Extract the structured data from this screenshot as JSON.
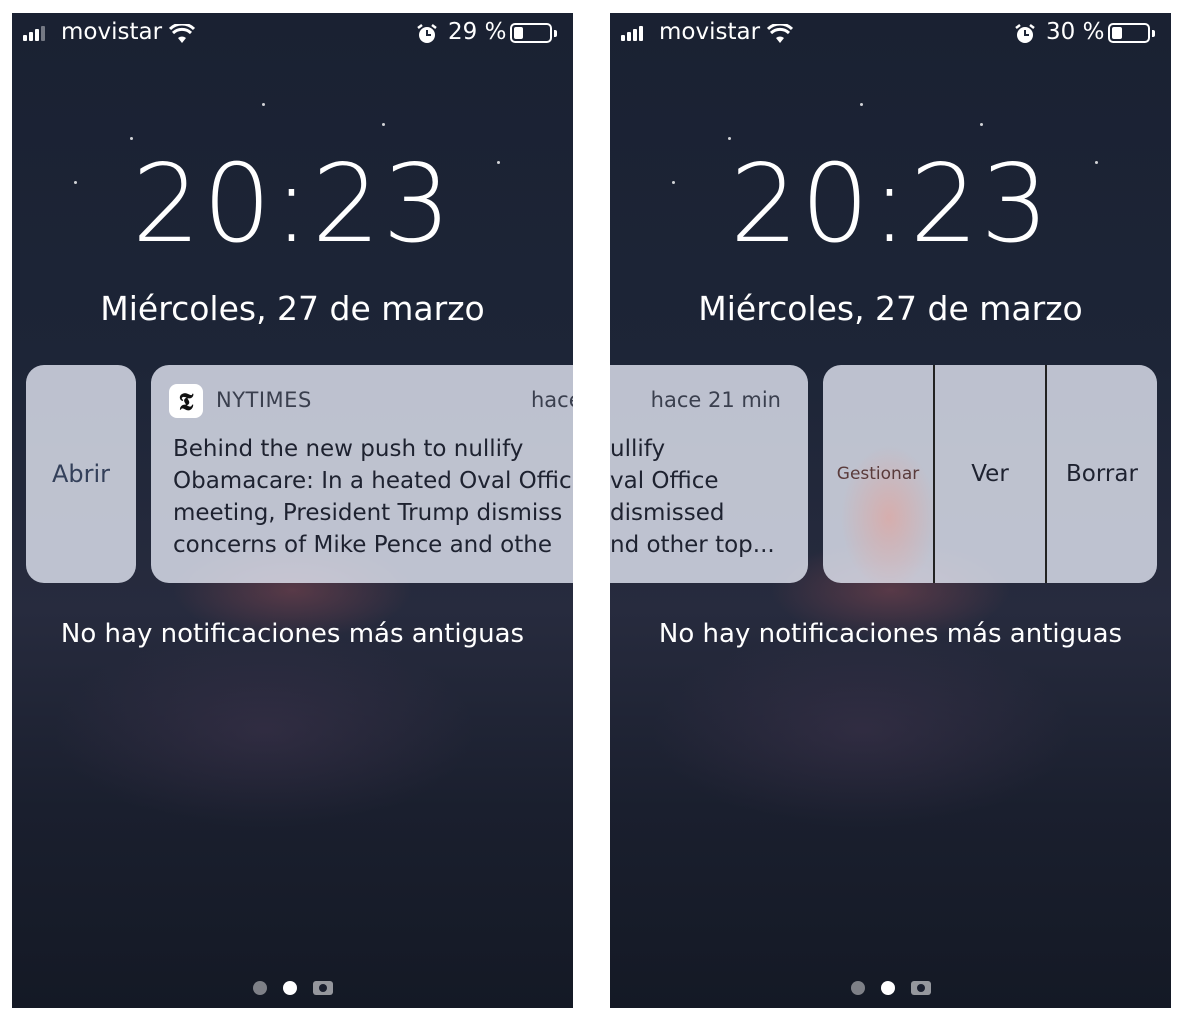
{
  "left": {
    "status": {
      "carrier": "movistar",
      "battery_pct": "29 %",
      "battery_level": 0.29
    },
    "clock": "20:23",
    "date": "Miércoles, 27 de marzo",
    "open_action": "Abrir",
    "notification": {
      "app": "NYTIMES",
      "time": "hace",
      "lines": [
        "Behind the new push to nullify",
        "Obamacare: In a heated Oval Offic",
        "meeting, President Trump dismiss",
        "concerns of Mike Pence and othe"
      ]
    },
    "older_text": "No hay notificaciones más antiguas"
  },
  "right": {
    "status": {
      "carrier": "movistar",
      "battery_pct": "30 %",
      "battery_level": 0.3
    },
    "clock": "20:23",
    "date": "Miércoles, 27 de marzo",
    "notification": {
      "time": "hace 21 min",
      "lines": [
        "ullify",
        "val Office",
        "dismissed",
        "nd other top..."
      ]
    },
    "actions": {
      "manage": "Gestionar",
      "view": "Ver",
      "clear": "Borrar"
    },
    "older_text": "No hay notificaciones más antiguas"
  },
  "icons": {
    "signal": "signal-icon",
    "wifi": "wifi-icon",
    "alarm": "alarm-icon",
    "battery": "battery-icon",
    "app": "nytimes-logo-icon",
    "camera": "camera-icon"
  }
}
